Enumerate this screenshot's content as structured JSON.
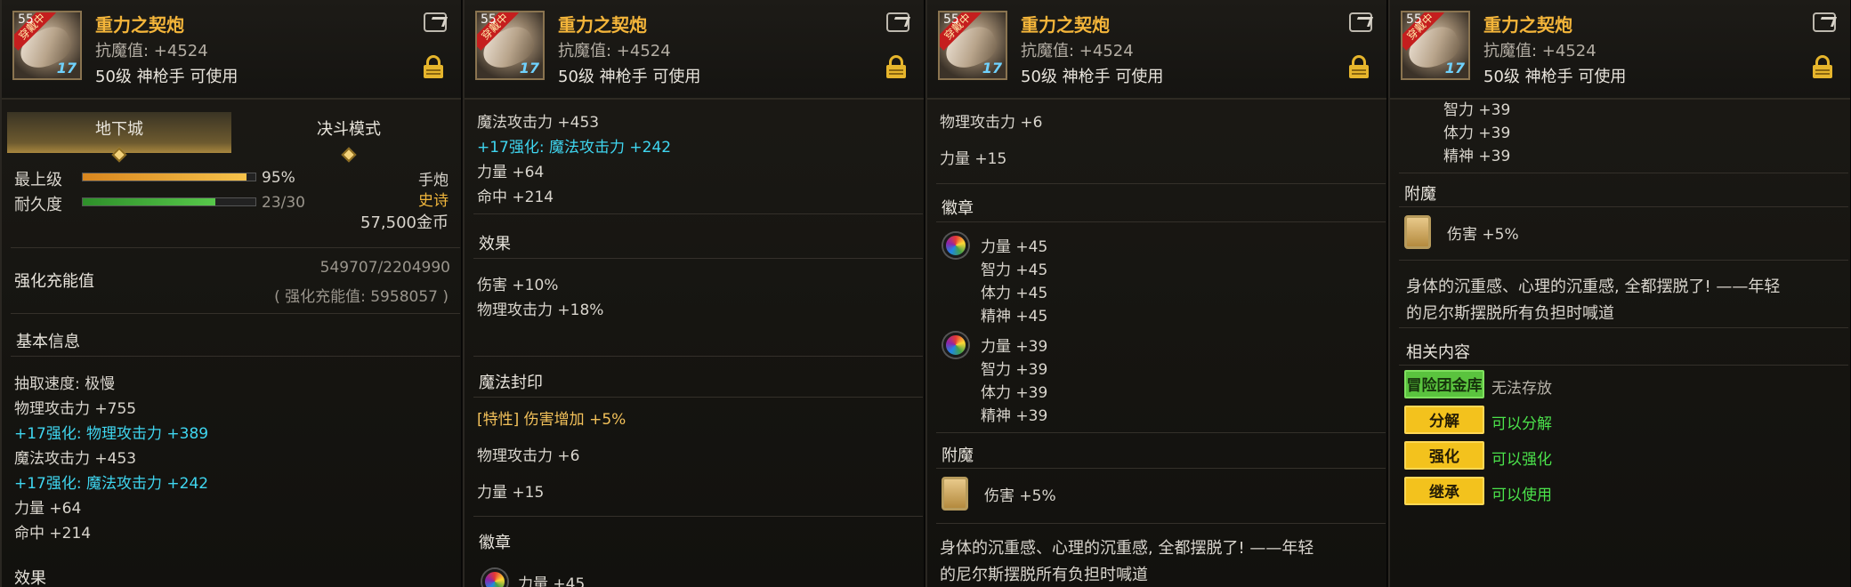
{
  "item": {
    "name": "重力之契炮",
    "magic_resist": "抗魔值: +4524",
    "requirement": "50级 神枪手 可使用",
    "icon_equipped_tag": "穿戴中",
    "icon_level": "55",
    "icon_plus": "17"
  },
  "panel1": {
    "tabs": [
      "地下城",
      "决斗模式"
    ],
    "grade_label": "最上级",
    "grade_pct": "95%",
    "grade_fill": 0.95,
    "durability_label": "耐久度",
    "durability_value": "23/30",
    "durability_fill": 0.7667,
    "weapon_type": "手炮",
    "rarity": "史诗",
    "price": "57,500金币",
    "charge_label": "强化充能值",
    "charge_value": "549707/2204990",
    "charge_sub": "( 强化充能值: 5958057 )",
    "basic_info": "基本信息",
    "lines": [
      {
        "text": "抽取速度: 极慢",
        "color": "w"
      },
      {
        "text": "物理攻击力 +755",
        "color": "w"
      },
      {
        "text": "+17强化: 物理攻击力 +389",
        "color": "cy"
      },
      {
        "text": "魔法攻击力 +453",
        "color": "w"
      },
      {
        "text": "+17强化: 魔法攻击力 +242",
        "color": "cy"
      },
      {
        "text": "力量 +64",
        "color": "w"
      },
      {
        "text": "命中 +214",
        "color": "w"
      }
    ],
    "effect_cut": "效果"
  },
  "panel2": {
    "top_lines": [
      {
        "text": "魔法攻击力 +453",
        "color": "w"
      },
      {
        "text": "+17强化: 魔法攻击力 +242",
        "color": "cy"
      },
      {
        "text": "力量 +64",
        "color": "w"
      },
      {
        "text": "命中 +214",
        "color": "w"
      }
    ],
    "effect_header": "效果",
    "effects": [
      "伤害 +10%",
      "物理攻击力 +18%"
    ],
    "seal_header": "魔法封印",
    "seal_trait": "[特性] 伤害增加 +5%",
    "seal_lines": [
      "物理攻击力 +6",
      "力量 +15"
    ],
    "emblem_header": "徽章",
    "emblem_cut": "力量 +45"
  },
  "panel3": {
    "seal_lines": [
      "物理攻击力 +6",
      "力量 +15"
    ],
    "emblem_header": "徽章",
    "emblem1": [
      "力量 +45",
      "智力 +45",
      "体力 +45",
      "精神 +45"
    ],
    "emblem2": [
      "力量 +39",
      "智力 +39",
      "体力 +39",
      "精神 +39"
    ],
    "enchant_header": "附魔",
    "enchant_value": "伤害 +5%",
    "flavor1": "身体的沉重感、心理的沉重感, 全都摆脱了! ——年轻",
    "flavor2": "的尼尔斯摆脱所有负担时喊道"
  },
  "panel4": {
    "emblem_tail": [
      "智力 +39",
      "体力 +39",
      "精神 +39"
    ],
    "enchant_header": "附魔",
    "enchant_value": "伤害 +5%",
    "flavor1": "身体的沉重感、心理的沉重感, 全都摆脱了! ——年轻",
    "flavor2": "的尼尔斯摆脱所有负担时喊道",
    "related_header": "相关内容",
    "rows": [
      {
        "button": "冒险团金库",
        "status": "无法存放"
      },
      {
        "button": "分解",
        "status": "可以分解"
      },
      {
        "button": "强化",
        "status": "可以强化"
      },
      {
        "button": "继承",
        "status": "可以使用"
      }
    ]
  }
}
